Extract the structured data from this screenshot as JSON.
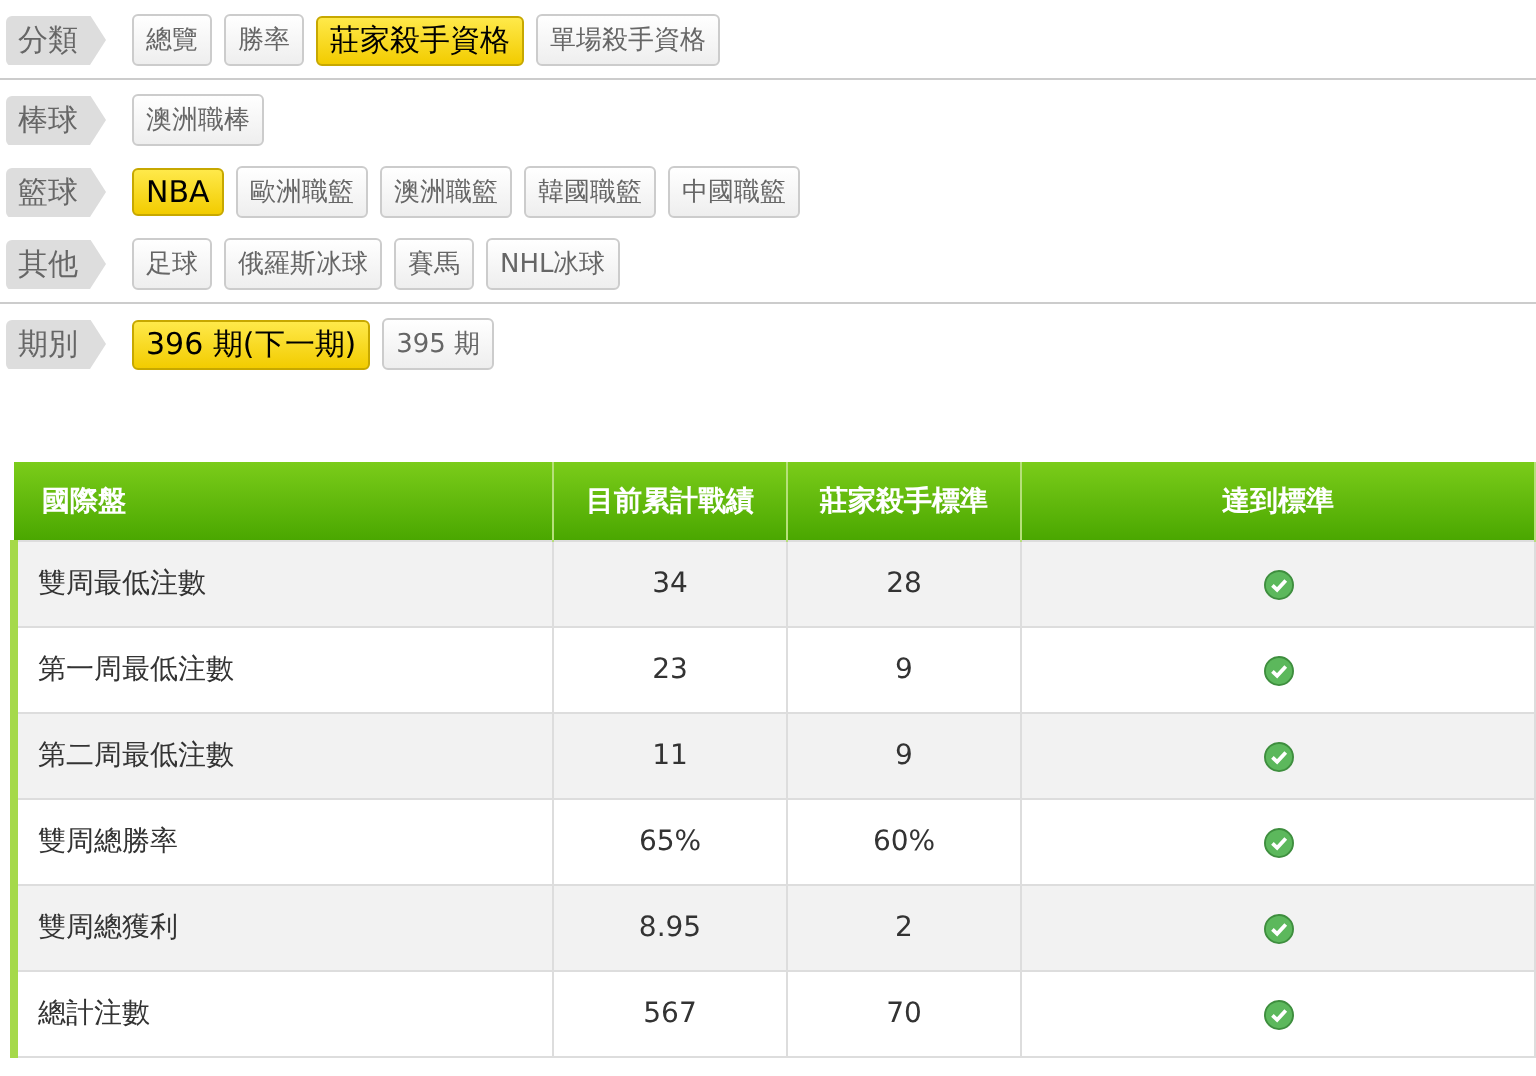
{
  "filter_sections": [
    {
      "groups": [
        {
          "label": "分類",
          "options": [
            {
              "text": "總覽",
              "selected": false
            },
            {
              "text": "勝率",
              "selected": false
            },
            {
              "text": "莊家殺手資格",
              "selected": true
            },
            {
              "text": "單場殺手資格",
              "selected": false
            }
          ]
        }
      ]
    },
    {
      "groups": [
        {
          "label": "棒球",
          "options": [
            {
              "text": "澳洲職棒",
              "selected": false
            }
          ]
        },
        {
          "label": "籃球",
          "options": [
            {
              "text": "NBA",
              "selected": true
            },
            {
              "text": "歐洲職籃",
              "selected": false
            },
            {
              "text": "澳洲職籃",
              "selected": false
            },
            {
              "text": "韓國職籃",
              "selected": false
            },
            {
              "text": "中國職籃",
              "selected": false
            }
          ]
        },
        {
          "label": "其他",
          "options": [
            {
              "text": "足球",
              "selected": false
            },
            {
              "text": "俄羅斯冰球",
              "selected": false
            },
            {
              "text": "賽馬",
              "selected": false
            },
            {
              "text": "NHL冰球",
              "selected": false
            }
          ]
        }
      ]
    },
    {
      "groups": [
        {
          "label": "期別",
          "options": [
            {
              "text": "396 期(下一期)",
              "selected": true
            },
            {
              "text": "395 期",
              "selected": false
            }
          ]
        }
      ]
    }
  ],
  "table": {
    "columns": [
      "國際盤",
      "目前累計戰績",
      "莊家殺手標準",
      "達到標準"
    ],
    "rows": [
      {
        "name": "雙周最低注數",
        "current": "34",
        "standard": "28",
        "met": true
      },
      {
        "name": "第一周最低注數",
        "current": "23",
        "standard": "9",
        "met": true
      },
      {
        "name": "第二周最低注數",
        "current": "11",
        "standard": "9",
        "met": true
      },
      {
        "name": "雙周總勝率",
        "current": "65%",
        "standard": "60%",
        "met": true
      },
      {
        "name": "雙周總獲利",
        "current": "8.95",
        "standard": "2",
        "met": true
      },
      {
        "name": "總計注數",
        "current": "567",
        "standard": "70",
        "met": true
      }
    ]
  }
}
